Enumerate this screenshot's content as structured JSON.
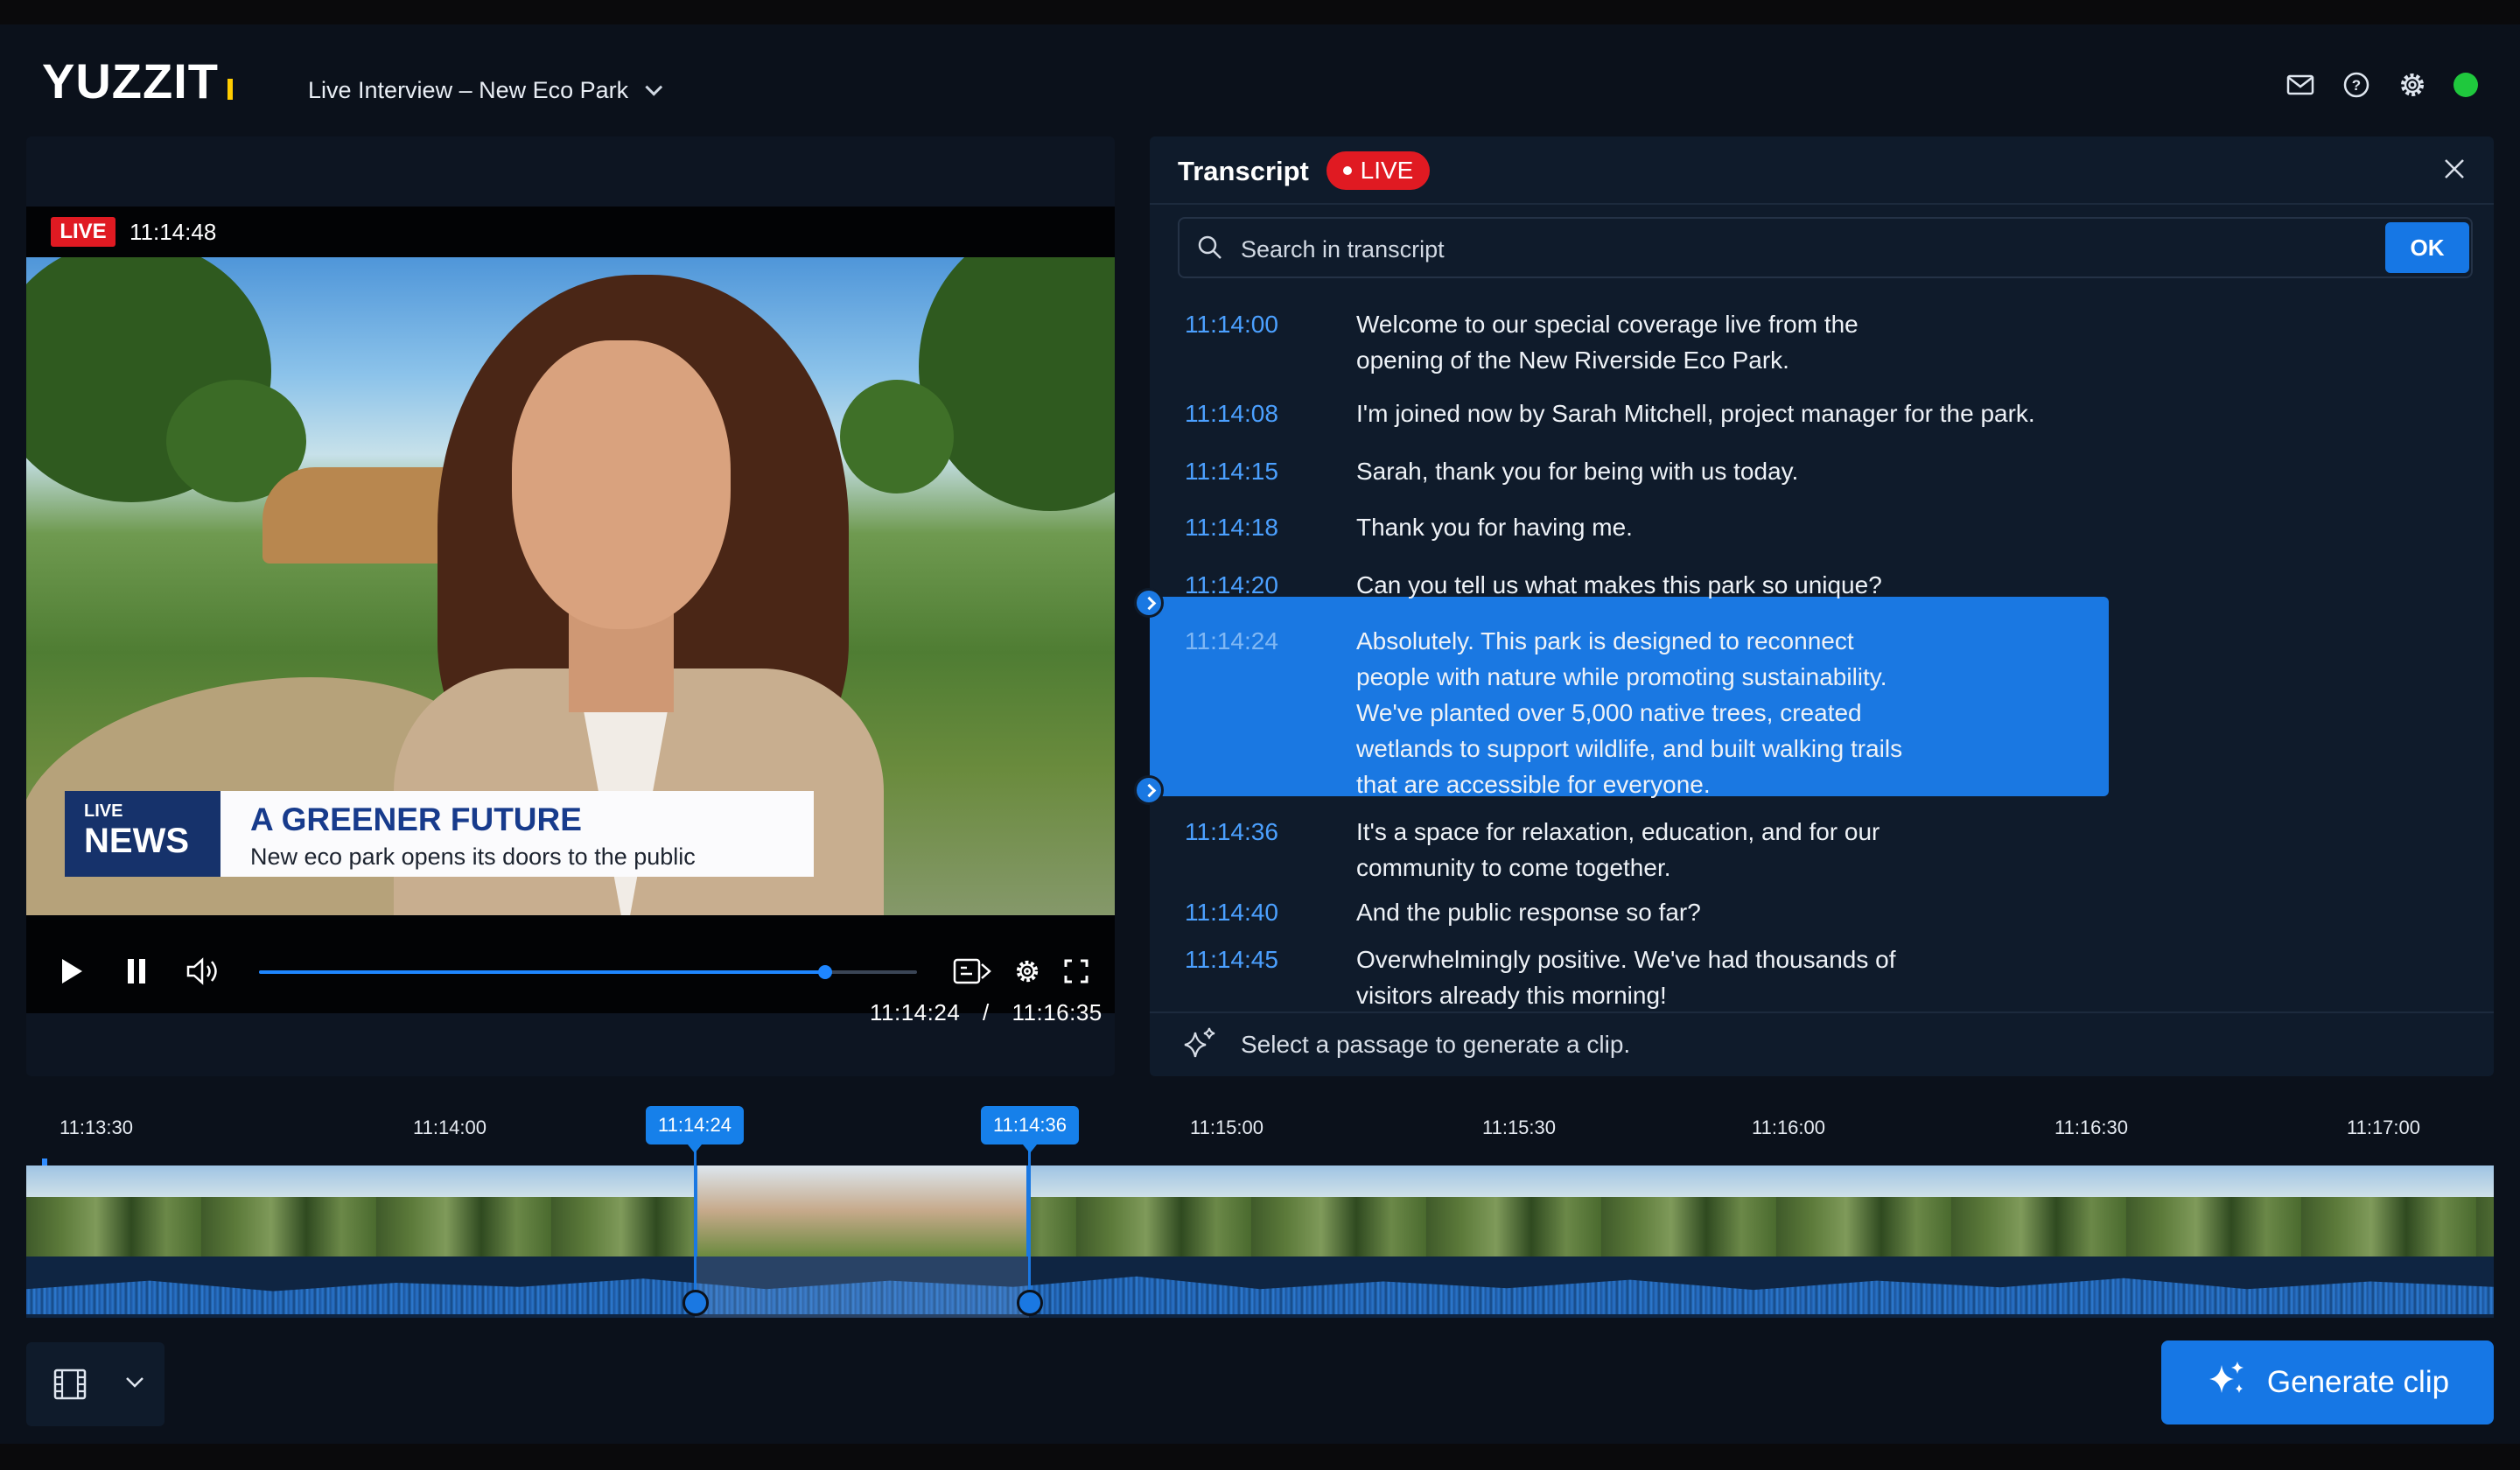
{
  "app": {
    "logo": "YUZZIT",
    "project_title": "Live Interview – New Eco Park"
  },
  "header_icons": [
    "mail-icon",
    "help-icon",
    "gear-icon",
    "status-online"
  ],
  "player": {
    "live_badge": "LIVE",
    "live_time": "11:14:48",
    "lower_third": {
      "live_small": "LIVE",
      "news": "NEWS",
      "headline": "A GREENER FUTURE",
      "subline": "New eco park opens its doors to the public"
    },
    "current_time": "11:14:24",
    "separator": "/",
    "duration": "11:16:35",
    "progress": 0.86
  },
  "transcript": {
    "title": "Transcript",
    "live_badge": "LIVE",
    "search_placeholder": "Search in transcript",
    "ok_label": "OK",
    "lines": [
      {
        "time": "11:14:00",
        "text": "Welcome to our special coverage live from the opening of the New Riverside Eco Park."
      },
      {
        "time": "11:14:08",
        "text": "I'm joined now by Sarah Mitchell, project manager for the park."
      },
      {
        "time": "11:14:15",
        "text": "Sarah, thank you for being with us today."
      },
      {
        "time": "11:14:18",
        "text": "Thank you for having me."
      },
      {
        "time": "11:14:20",
        "text": "Can you tell us what makes this park so unique?"
      },
      {
        "time": "11:14:24",
        "text": "Absolutely. This park is designed to reconnect people with nature while promoting sustainability. We've planted over 5,000 native trees, created wetlands to support wildlife, and built walking trails that are accessible for everyone."
      },
      {
        "time": "11:14:36",
        "text": "It's a space for relaxation, education, and for our community to come together."
      },
      {
        "time": "11:14:40",
        "text": "And the public response so far?"
      },
      {
        "time": "11:14:45",
        "text": "Overwhelmingly positive. We've had thousands of visitors already this morning!"
      }
    ],
    "selected_index": 5,
    "hint": "Select a passage to generate a clip."
  },
  "timeline": {
    "ticks": [
      "11:13:30",
      "11:14:00",
      "11:15:00",
      "11:15:30",
      "11:16:00",
      "11:16:30",
      "11:17:00"
    ],
    "selection_start": "11:14:24",
    "selection_end": "11:14:36"
  },
  "actions": {
    "generate_clip": "Generate clip"
  },
  "colors": {
    "accent": "#1677e5",
    "live": "#e01a22",
    "timestamp": "#4ba0ff",
    "status_online": "#1fc83d"
  }
}
